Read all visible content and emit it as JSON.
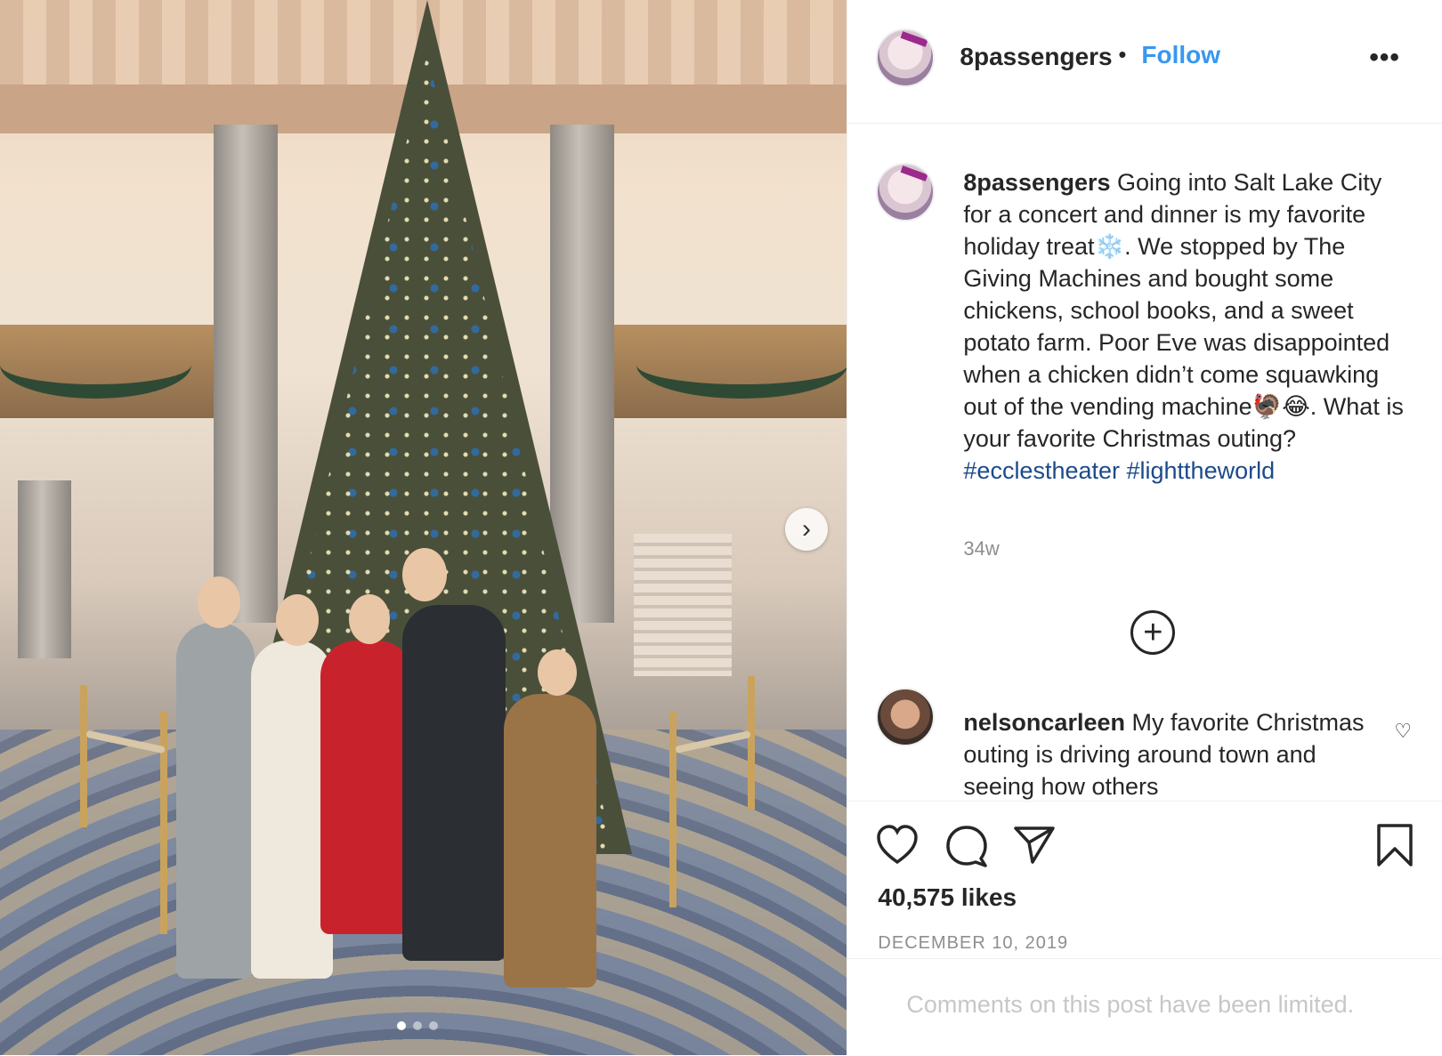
{
  "photo": {
    "alt_icons": {
      "next": "chevron-right-icon"
    },
    "carousel": {
      "dots": 3,
      "active": 0
    }
  },
  "header": {
    "username": "8passengers",
    "separator": "•",
    "follow_label": "Follow",
    "more_label": "•••"
  },
  "caption": {
    "username": "8passengers",
    "text": "Going into Salt Lake City for a concert and dinner is my favorite holiday treat❄️. We stopped by The Giving Machines and bought some chickens, school books, and a sweet potato farm. Poor Eve was disappointed when a chicken didn’t come squawking out of the vending machine🦃😂. What is your favorite Christmas outing?",
    "hashtags": "#ecclestheater #lighttheworld",
    "time": "34w"
  },
  "load_more_icon": "plus-circle-icon",
  "comment": {
    "username": "nelsoncarleen",
    "text": "My favorite Christmas outing is driving around town and seeing how others"
  },
  "actions": {
    "like_icon": "heart-icon",
    "comment_icon": "comment-icon",
    "share_icon": "share-icon",
    "save_icon": "bookmark-icon"
  },
  "likes": "40,575 likes",
  "date": "DECEMBER 10, 2019",
  "comments_limited": "Comments on this post have been limited.",
  "colors": {
    "link": "#3897f0",
    "hashtag": "#1c4a8c",
    "muted": "#8e8e8e"
  }
}
